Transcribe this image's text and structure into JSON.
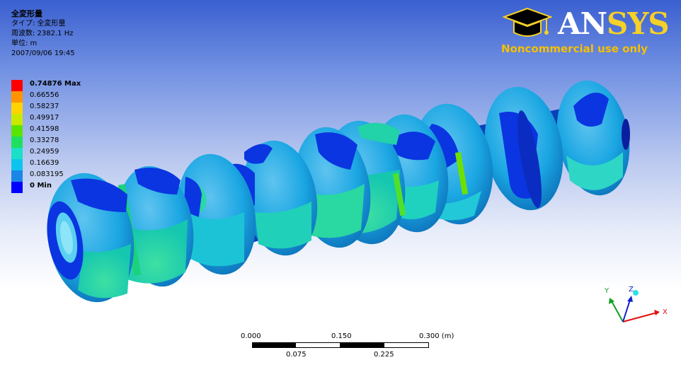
{
  "result": {
    "title": "全変形量",
    "type_line": "タイプ: 全変形量",
    "frequency_line": "周波数: 2382.1 Hz",
    "unit_line": "単位: m",
    "timestamp": "2007/09/06 19:45"
  },
  "legend": {
    "entries": [
      {
        "label": "0.74876 Max",
        "color": "#ff0000",
        "bold": true
      },
      {
        "label": "0.66556",
        "color": "#ff9400",
        "bold": false
      },
      {
        "label": "0.58237",
        "color": "#ffd400",
        "bold": false
      },
      {
        "label": "0.49917",
        "color": "#c9ea00",
        "bold": false
      },
      {
        "label": "0.41598",
        "color": "#5ae400",
        "bold": false
      },
      {
        "label": "0.33278",
        "color": "#1fe05e",
        "bold": false
      },
      {
        "label": "0.24959",
        "color": "#1ae0c8",
        "bold": false
      },
      {
        "label": "0.16639",
        "color": "#0fc4ec",
        "bold": false
      },
      {
        "label": "0.083195",
        "color": "#1a86e6",
        "bold": false
      },
      {
        "label": "0 Min",
        "color": "#0000ff",
        "bold": true
      }
    ]
  },
  "logo": {
    "brand_an": "AN",
    "brand_sys": "SYS",
    "noncommercial": "Noncommercial use only",
    "icon": "graduation-cap-icon"
  },
  "scale_bar": {
    "top_labels": [
      "0.000",
      "0.150",
      "0.300 (m)"
    ],
    "bottom_labels": [
      "0.075",
      "0.225"
    ]
  },
  "triad": {
    "x_label": "X",
    "y_label": "Y",
    "z_label": "Z"
  }
}
